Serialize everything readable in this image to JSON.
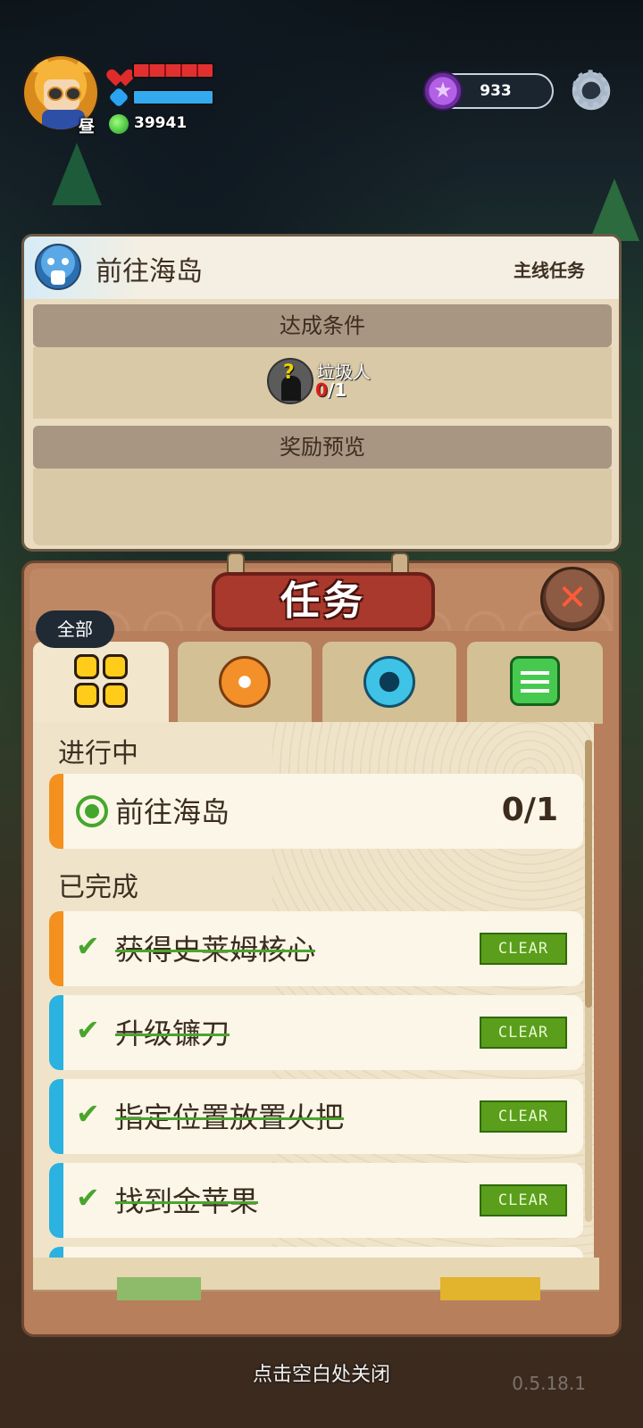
{
  "hud": {
    "day_tag": "昼",
    "gold": "39941",
    "currency_value": "933"
  },
  "quest_detail": {
    "title": "前往海岛",
    "type": "主线任务",
    "conditions_header": "达成条件",
    "condition": {
      "icon_glyph": "?",
      "name": "垃圾人",
      "current": "0",
      "total": "/1"
    },
    "rewards_header": "奖励预览"
  },
  "task_panel": {
    "title": "任务",
    "close_glyph": "✕",
    "active_tab_label": "全部",
    "in_progress_title": "进行中",
    "completed_title": "已完成",
    "in_progress": [
      {
        "name": "前往海岛",
        "progress": "0/1",
        "accent": "#f3901e"
      }
    ],
    "completed": [
      {
        "name": "获得史莱姆核心",
        "badge": "CLEAR",
        "accent": "#f3901e"
      },
      {
        "name": "升级镰刀",
        "badge": "CLEAR",
        "accent": "#2bb2e0"
      },
      {
        "name": "指定位置放置火把",
        "badge": "CLEAR",
        "accent": "#2bb2e0"
      },
      {
        "name": "找到金苹果",
        "badge": "CLEAR",
        "accent": "#2bb2e0"
      }
    ]
  },
  "footer": {
    "close_hint": "点击空白处关闭",
    "version": "0.5.18.1"
  }
}
